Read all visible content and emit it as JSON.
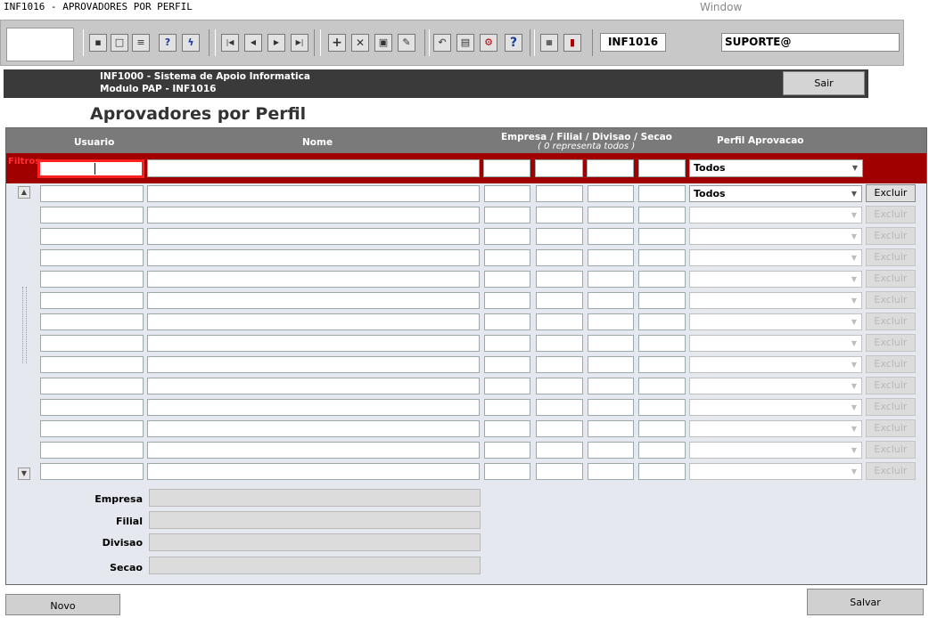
{
  "window": {
    "title": "INF1016 - APROVADORES POR PERFIL",
    "menu": "Window"
  },
  "toolbar": {
    "module_code": "INF1016",
    "user": "SUPORTE@"
  },
  "banner": {
    "line1": "INF1000 - Sistema de Apoio Informatica",
    "line2": "Modulo PAP - INF1016",
    "sair_label": "Sair"
  },
  "page": {
    "title": "Aprovadores por Perfil"
  },
  "grid": {
    "headers": {
      "usuario": "Usuario",
      "nome": "Nome",
      "org": "Empresa / Filial / Divisao / Secao",
      "org_hint": "( 0 representa todos )",
      "perfil": "Perfil Aprovacao"
    },
    "filter_label": "Filtros",
    "filter_perfil": "Todos",
    "first_row_perfil": "Todos",
    "excluir_label": "Excluir"
  },
  "details": {
    "empresa": "Empresa",
    "filial": "Filial",
    "divisao": "Divisao",
    "secao": "Secao"
  },
  "actions": {
    "novo": "Novo",
    "salvar": "Salvar"
  }
}
